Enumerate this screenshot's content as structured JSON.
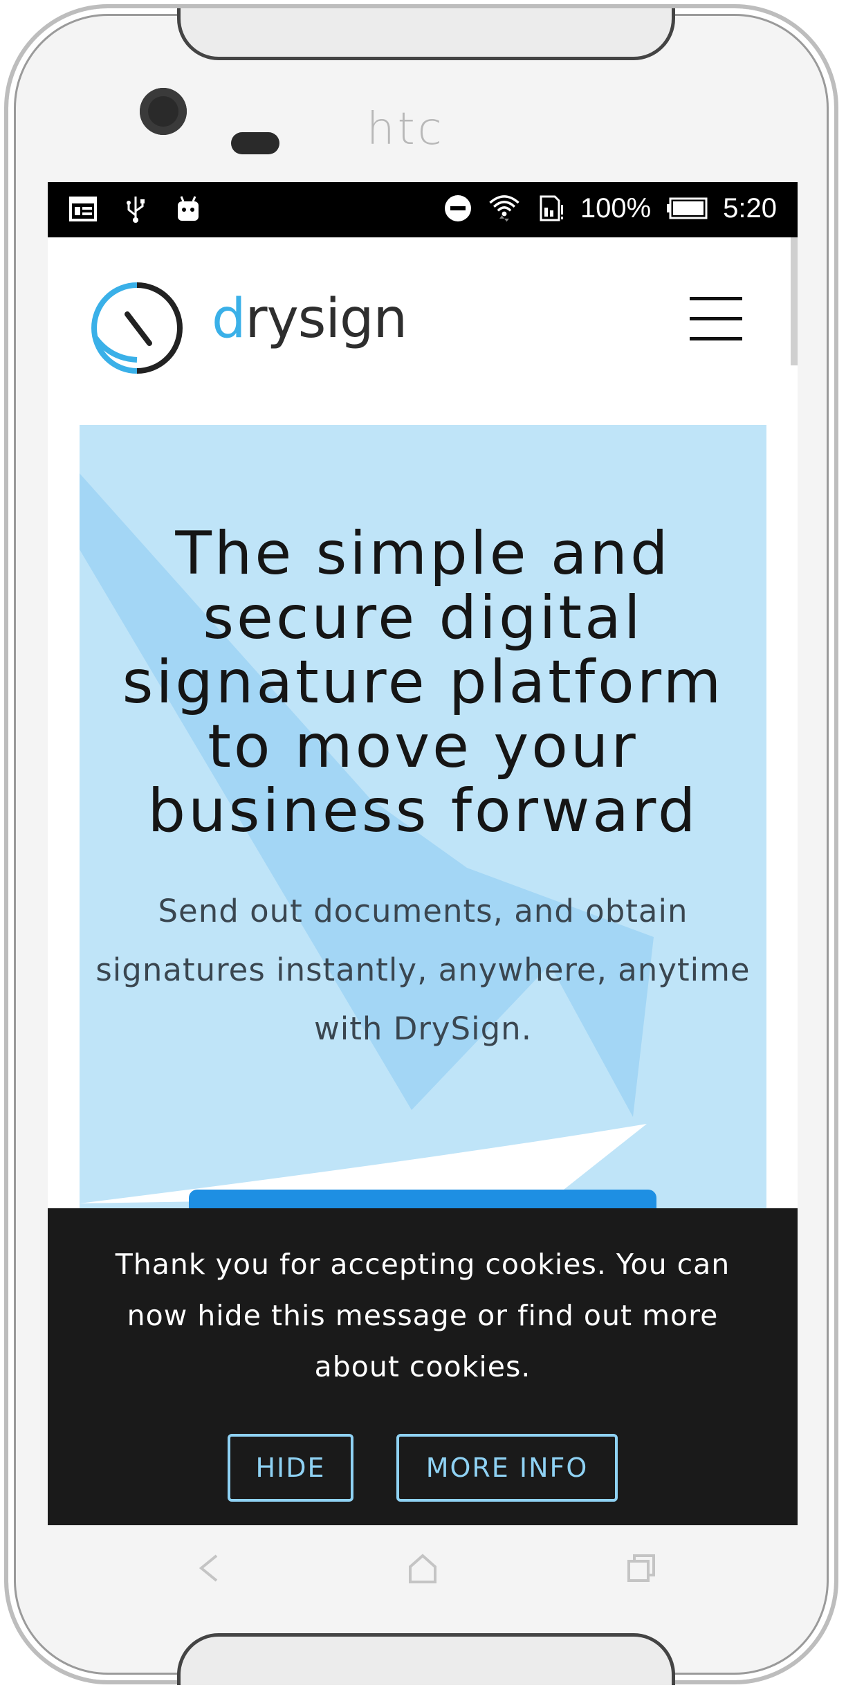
{
  "device": {
    "brand": "htc"
  },
  "status_bar": {
    "left_icons": [
      "calendar-icon",
      "usb-icon",
      "android-icon"
    ],
    "right_icons": [
      "do-not-disturb-icon",
      "wifi-icon",
      "sim-card-icon"
    ],
    "battery_percent": "100%",
    "time": "5:20"
  },
  "header": {
    "logo_text_accent": "d",
    "logo_text_rest": "rysign",
    "accent_color": "#3ab0e8"
  },
  "hero": {
    "title": "The simple and secure digital signature platform to move your business forward",
    "subtitle": "Send out documents, and obtain signatures instantly, anywhere, anytime with DrySign.",
    "background_color": "#bfe4f8",
    "cta_color": "#1e8fe3"
  },
  "cookie_banner": {
    "message": "Thank you for accepting cookies. You can now hide this message or find out more about cookies.",
    "hide_label": "HIDE",
    "more_info_label": "MORE INFO",
    "button_color": "#8fd2f4"
  },
  "nav_bar": {
    "icons": [
      "back-icon",
      "home-icon",
      "recents-icon"
    ]
  }
}
